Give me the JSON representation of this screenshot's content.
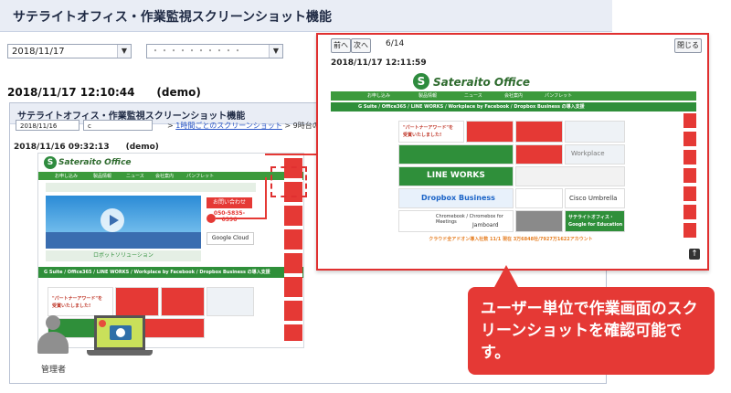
{
  "header": {
    "title": "サテライトオフィス・作業監視スクリーンショット機能"
  },
  "filters": {
    "date": "2018/11/17",
    "user": "・・・・・・・・・・",
    "user_arrow": "▼",
    "date_arrow": "▼"
  },
  "main": {
    "timestamp": "2018/11/17 12:10:44　　(demo)"
  },
  "inner": {
    "title": "サテライトオフィス・作業監視スクリーンショット機能",
    "date": "2018/11/16",
    "user": "c",
    "breadcrumb_prefix": ">",
    "breadcrumb_link": "1時間ごとのスクリーンショット",
    "breadcrumb_rest": "> 9時台のスクリー",
    "timestamp": "2018/11/16 09:32:13　　(demo)"
  },
  "site": {
    "logo_text": "Sateraito Office",
    "logo_sub": "サテライトオフィス",
    "nav_items": [
      "お申し込み",
      "製品情報",
      "ニュース",
      "会社案内",
      "パンフレット"
    ],
    "bar_text": "G Suite / Office365 / LINE WORKS / Workplace by Facebook / Dropbox Business の導入支援",
    "award_line1": "\"パートナーアワード\"を",
    "award_line2": "受賞いたしました!",
    "gfe": "Google for Education",
    "gfe_title": "サテライトオフィス・",
    "lineworks": "LINE WORKS",
    "dropbox": "Dropbox Business",
    "cisco": "Cisco Umbrella",
    "jamboard": "Jamboard",
    "chromebook": "Chromebook / Chromebox for Meetings",
    "workplace": "Workplace",
    "count_text": "クラウド全アドオン導入社数 11/1 現在 3万6848社/7927万1622アカウント",
    "robot": "ロボットソリューション",
    "contact": "お問い合わせ",
    "phone": "050-5835-0396",
    "google_cloud": "Google Cloud"
  },
  "popup": {
    "prev_label": "前へ",
    "next_label": "次へ",
    "counter": "6/14",
    "close_label": "閉じる",
    "timestamp": "2018/11/17 12:11:59"
  },
  "admin": {
    "label": "管理者"
  },
  "callout": {
    "text": "ユーザー単位で作業画面のスクリーンショットを確認可能です。"
  },
  "colors": {
    "accent_red": "#e53935",
    "brand_green": "#2f8f3a",
    "header_bg": "#e9edf5"
  }
}
